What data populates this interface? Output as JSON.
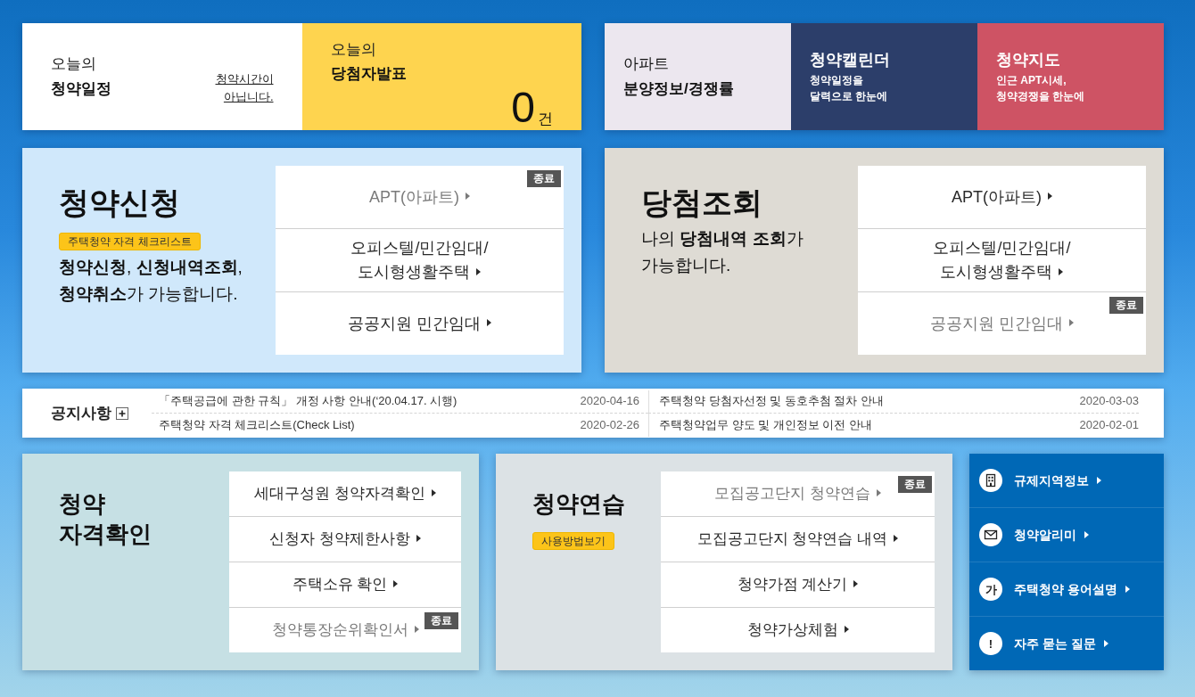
{
  "today_cards": [
    {
      "kind": "schedule",
      "label": "오늘의",
      "title": "청약일정",
      "link": "청약시간이\n아닙니다."
    },
    {
      "kind": "announcement",
      "label": "오늘의",
      "title": "당첨자발표",
      "count": "0",
      "unit": "건"
    }
  ],
  "quick_cards": [
    {
      "kind": "info",
      "label": "아파트",
      "title": "분양정보/경쟁률"
    },
    {
      "kind": "calendar",
      "title": "청약캘린더",
      "description": "청약일정을\n달력으로 한눈에"
    },
    {
      "kind": "map",
      "title": "청약지도",
      "description": "인근 APT시세,\n청약경쟁을 한눈에"
    }
  ],
  "apply": {
    "title": "청약신청",
    "badge": "주택청약 자격 체크리스트",
    "description": "**청약신청**, **신청내역조회**,\n**청약취소**가 가능합니다.",
    "menu": [
      {
        "label": "APT(아파트)",
        "closed": true,
        "badge": "종료"
      },
      {
        "label": "오피스텔/민간임대/\n도시형생활주택",
        "closed": false
      },
      {
        "label": "공공지원 민간임대",
        "closed": false
      }
    ]
  },
  "results": {
    "title": "당첨조회",
    "description": "나의 **당첨내역 조회**가\n가능합니다.",
    "menu": [
      {
        "label": "APT(아파트)",
        "closed": false
      },
      {
        "label": "오피스텔/민간임대/\n도시형생활주택",
        "closed": false
      },
      {
        "label": "공공지원 민간임대",
        "closed": true,
        "badge": "종료"
      }
    ]
  },
  "notices": {
    "title": "공지사항",
    "items": [
      {
        "title": "「주택공급에 관한 규칙」 개정 사항 안내(‘20.04.17. 시행)",
        "date": "2020-04-16"
      },
      {
        "title": "주택청약 당첨자선정 및 동호추첨 절차 안내",
        "date": "2020-03-03"
      },
      {
        "title": "주택청약 자격 체크리스트(Check List)",
        "date": "2020-02-26"
      },
      {
        "title": "주택청약업무 양도 및 개인정보 이전 안내",
        "date": "2020-02-01"
      }
    ]
  },
  "eligibility": {
    "title": "청약\n자격확인",
    "menu": [
      {
        "label": "세대구성원 청약자격확인",
        "closed": false
      },
      {
        "label": "신청자 청약제한사항",
        "closed": false
      },
      {
        "label": "주택소유 확인",
        "closed": false
      },
      {
        "label": "청약통장순위확인서",
        "closed": true,
        "badge": "종료"
      }
    ]
  },
  "practice": {
    "title": "청약연습",
    "badge": "사용방법보기",
    "menu": [
      {
        "label": "모집공고단지 청약연습",
        "closed": true,
        "badge": "종료"
      },
      {
        "label": "모집공고단지 청약연습 내역",
        "closed": false
      },
      {
        "label": "청약가점 계산기",
        "closed": false
      },
      {
        "label": "청약가상체험",
        "closed": false
      }
    ]
  },
  "shortcuts": [
    {
      "kind": "building",
      "label": "규제지역정보"
    },
    {
      "kind": "envelope",
      "label": "청약알리미"
    },
    {
      "kind": "letter",
      "glyph": "가",
      "label": "주택청약 용어설명"
    },
    {
      "kind": "alert",
      "glyph": "!",
      "label": "자주 묻는 질문"
    }
  ]
}
